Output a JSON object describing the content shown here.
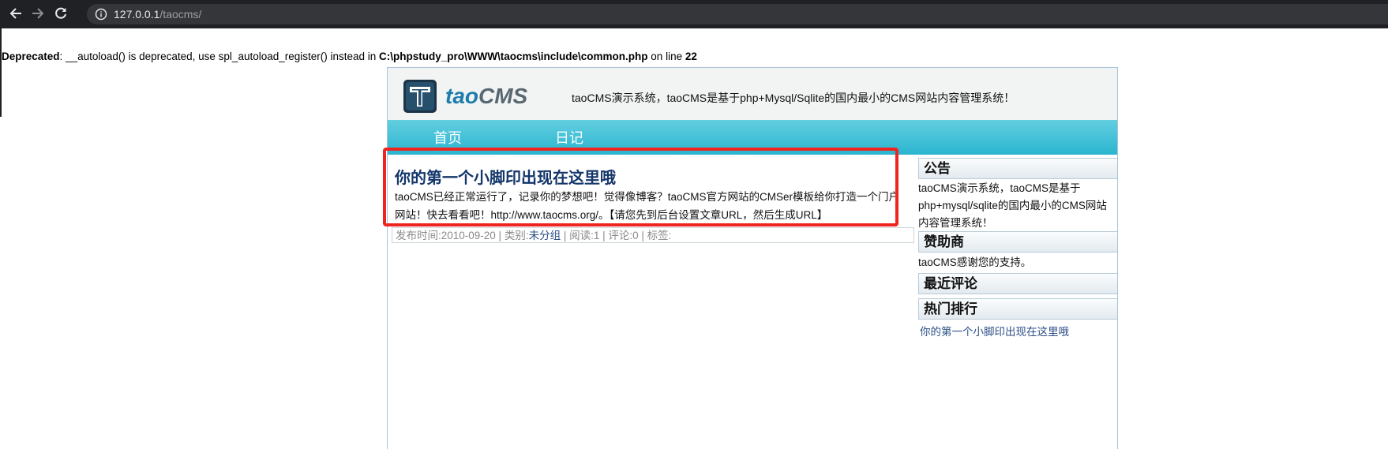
{
  "browser": {
    "url_host": "127.0.0.1",
    "url_path": "/taocms/"
  },
  "warning": {
    "label": "Deprecated",
    "message": ": __autoload() is deprecated, use spl_autoload_register() instead in ",
    "file": "C:\\phpstudy_pro\\WWW\\taocms\\include\\common.php",
    "line_prefix": " on line ",
    "line_number": "22"
  },
  "header": {
    "logo_part1": "tao",
    "logo_part2": "CMS",
    "slogan": "taoCMS演示系统，taoCMS是基于php+Mysql/Sqlite的国内最小的CMS网站内容管理系统！"
  },
  "nav": {
    "items": [
      "首页",
      "日记"
    ]
  },
  "post": {
    "title": "你的第一个小脚印出现在这里哦",
    "body": "taoCMS已经正常运行了，记录你的梦想吧！觉得像博客？taoCMS官方网站的CMSer模板给你打造一个门户网站！快去看看吧！http://www.taocms.org/。【请您先到后台设置文章URL，然后生成URL】",
    "meta_prefix": "发布时间:2010-09-20 | 类别:",
    "meta_category": "未分组",
    "meta_suffix": " | 阅读:1 | 评论:0 | 标签:"
  },
  "sidebar": {
    "notice_title": "公告",
    "notice_text": "taoCMS演示系统，taoCMS是基于php+mysql/sqlite的国内最小的CMS网站内容管理系统！",
    "sponsor_title": "赞助商",
    "sponsor_text": "taoCMS感谢您的支持。",
    "comments_title": "最近评论",
    "hot_title": "热门排行",
    "hot_items": [
      "你的第一个小脚印出现在这里哦"
    ]
  },
  "colors": {
    "chrome_bg": "#202124",
    "nav_bar": "#2ab5cf",
    "title_blue": "#14366a",
    "highlight_red": "#f0241f"
  },
  "icons": [
    "back-arrow-icon",
    "forward-arrow-icon",
    "reload-icon",
    "info-icon",
    "taocms-logo-icon"
  ]
}
